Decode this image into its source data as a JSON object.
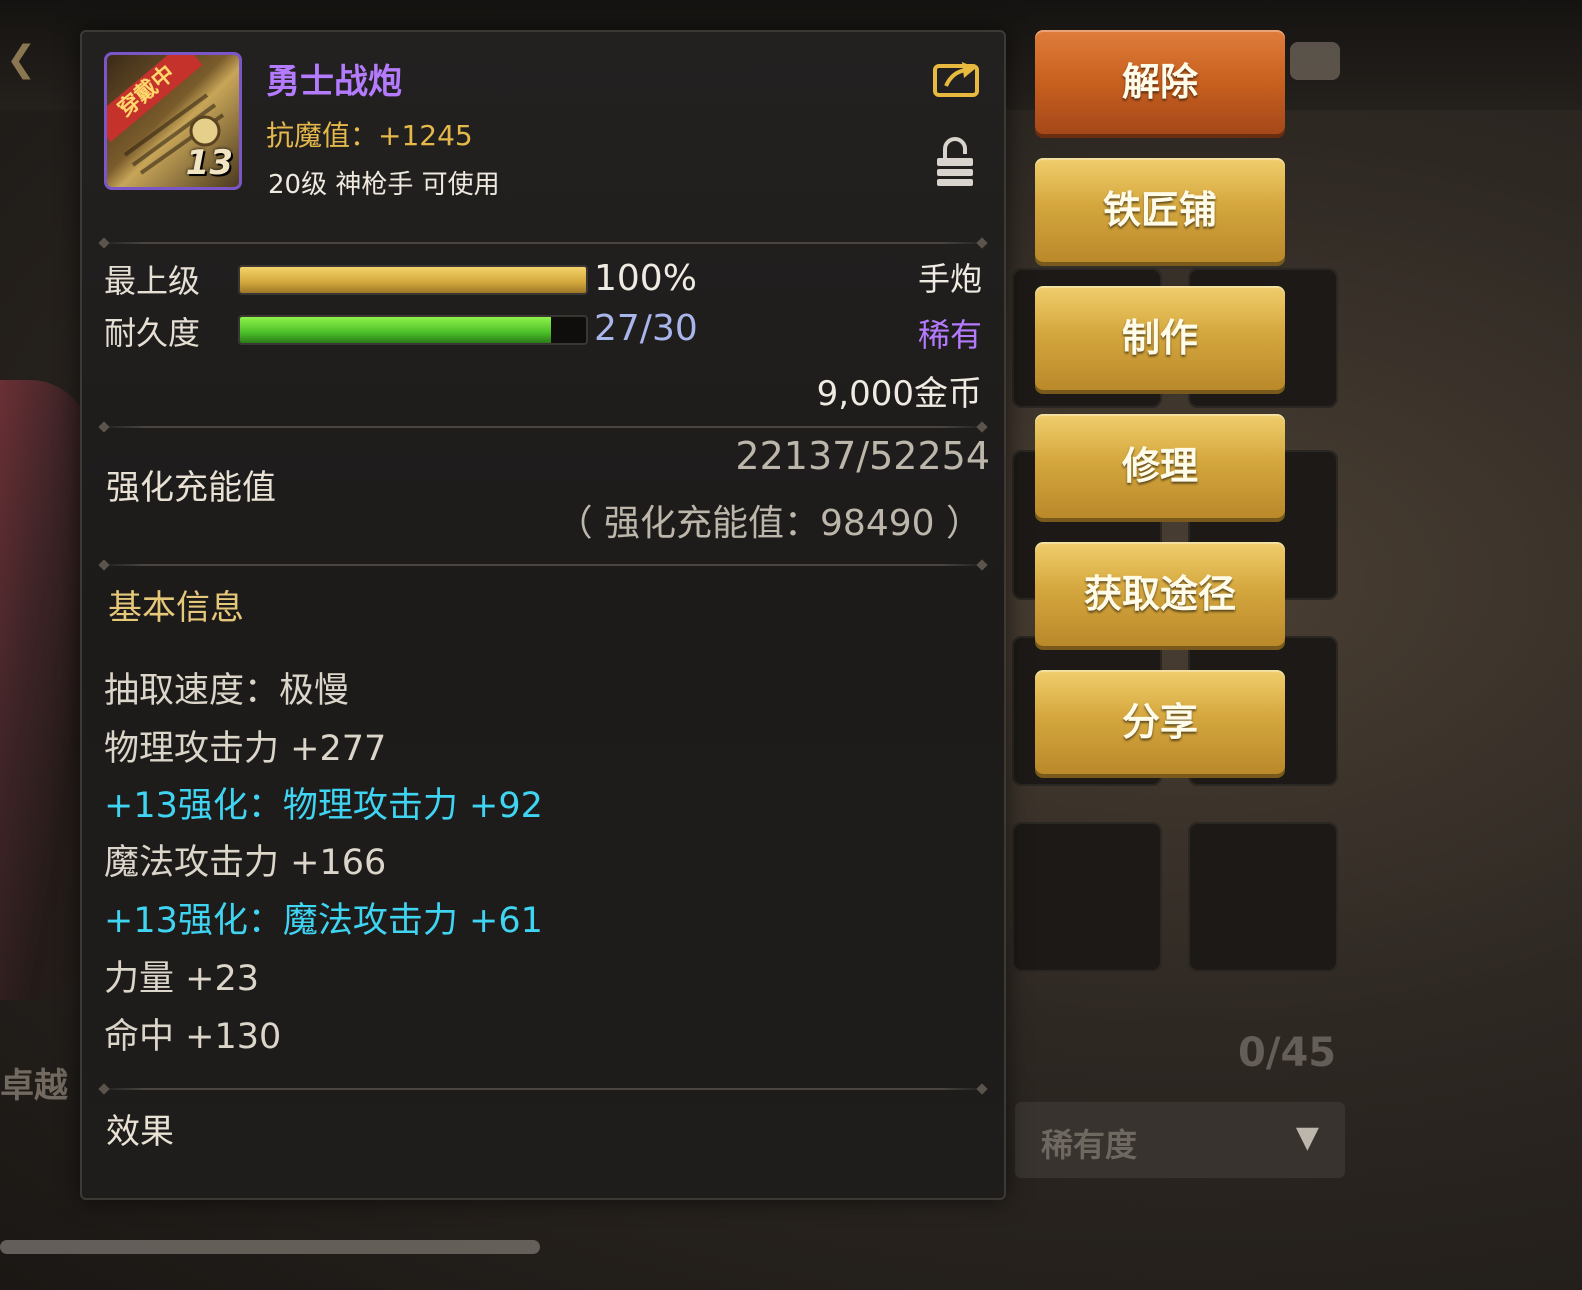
{
  "item": {
    "name": "勇士战炮",
    "magic_resistance": "抗魔值：+1245",
    "requirement": "20级 神枪手 可使用",
    "equip_badge": "穿戴中",
    "enhance_level": "13"
  },
  "grade": {
    "label": "最上级",
    "value": "100%",
    "fill": 1.0
  },
  "durability": {
    "label": "耐久度",
    "value": "27/30",
    "fill": 0.9
  },
  "weapon_type": "手炮",
  "rarity": "稀有",
  "price": "9,000金币",
  "charge": {
    "label": "强化充能值",
    "value": "22137/52254",
    "total": "（ 强化充能值：98490 ）"
  },
  "basic_info": {
    "title": "基本信息",
    "stats": [
      {
        "text": "抽取速度：极慢",
        "style": "white"
      },
      {
        "text": "物理攻击力 +277",
        "style": "white"
      },
      {
        "text": "+13强化：物理攻击力 +92",
        "style": "cyan"
      },
      {
        "text": "魔法攻击力 +166",
        "style": "white"
      },
      {
        "text": "+13强化：魔法攻击力 +61",
        "style": "cyan"
      },
      {
        "text": "力量 +23",
        "style": "white"
      },
      {
        "text": "命中 +130",
        "style": "white"
      }
    ]
  },
  "effect_title": "效果",
  "actions": [
    "解除",
    "铁匠铺",
    "制作",
    "修理",
    "获取途径",
    "分享"
  ],
  "background": {
    "left_text": "卓越",
    "inventory_count": "0/45",
    "sort_dropdown": "稀有度"
  },
  "colors": {
    "rare_purple": "#b57bff",
    "magic_res_gold": "#e4b84a",
    "enhance_cyan": "#3fd4f2",
    "button_gold": "#d5a73e",
    "button_orange": "#c8601f"
  },
  "icons": [
    "share-icon",
    "lock-icon",
    "weapon-hand-cannon-icon",
    "dropdown-arrow-icon"
  ]
}
